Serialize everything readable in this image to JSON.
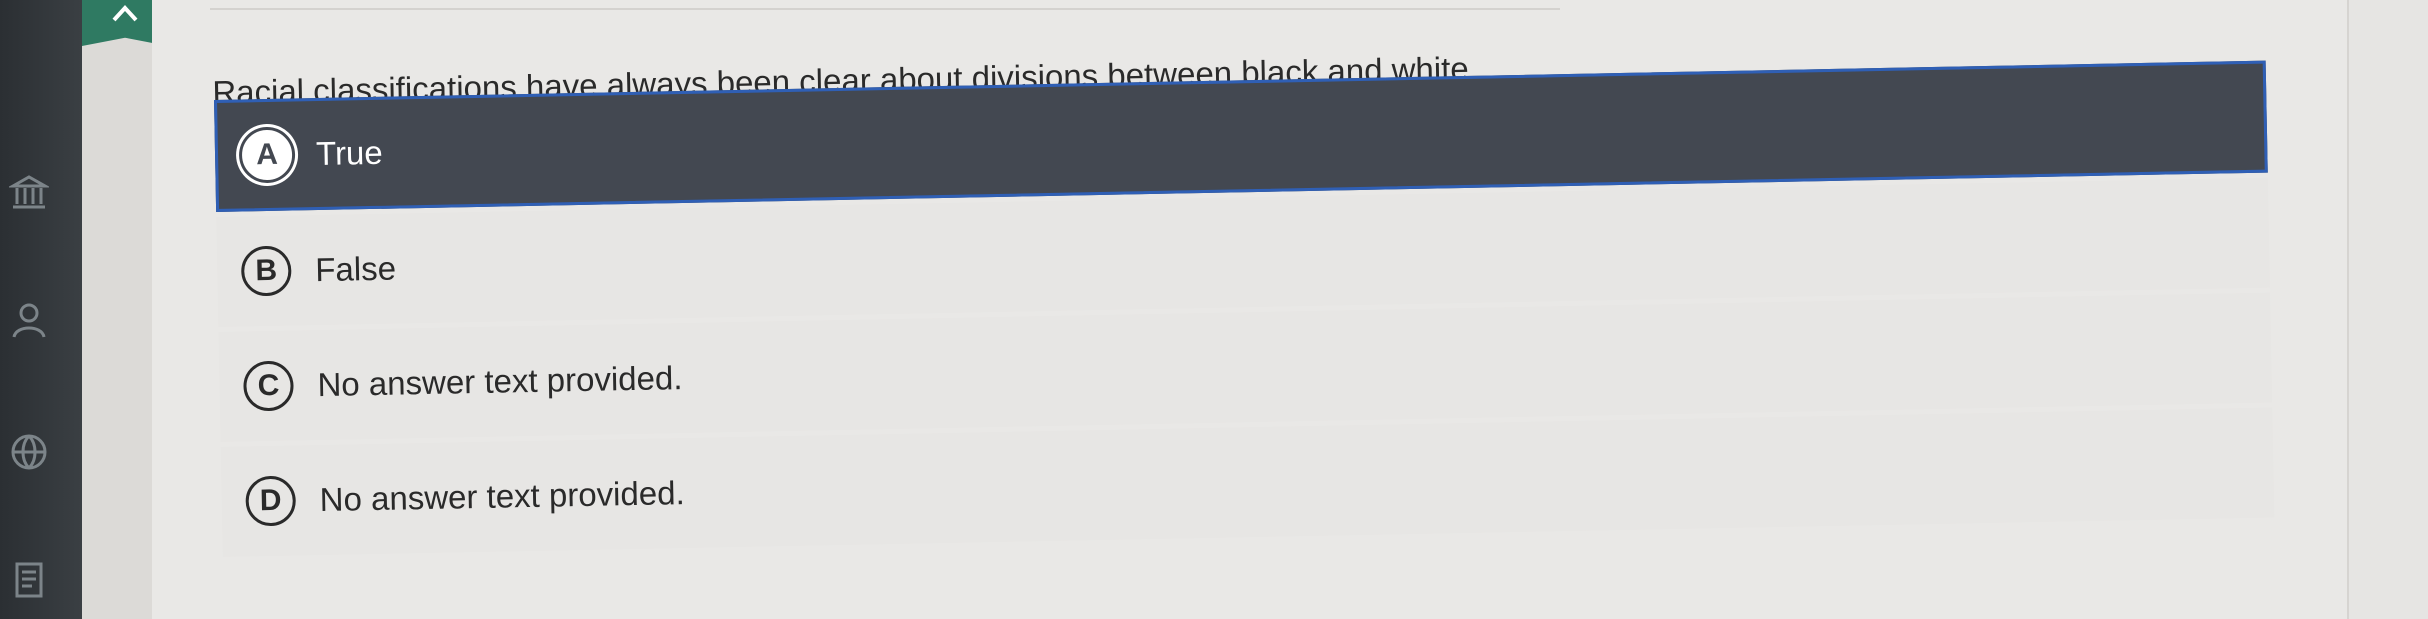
{
  "question": {
    "text": "Racial classifications have always been clear about divisions between black and white."
  },
  "options": [
    {
      "letter": "A",
      "text": "True",
      "selected": true
    },
    {
      "letter": "B",
      "text": "False",
      "selected": false
    },
    {
      "letter": "C",
      "text": "No answer text provided.",
      "selected": false
    },
    {
      "letter": "D",
      "text": "No answer text provided.",
      "selected": false
    }
  ],
  "rail_icons": [
    "institution-icon",
    "user-icon",
    "globe-icon",
    "document-icon"
  ],
  "colors": {
    "accent_green": "#2f7a62",
    "selected_background": "#434851",
    "selected_border": "#2f5fb5"
  }
}
